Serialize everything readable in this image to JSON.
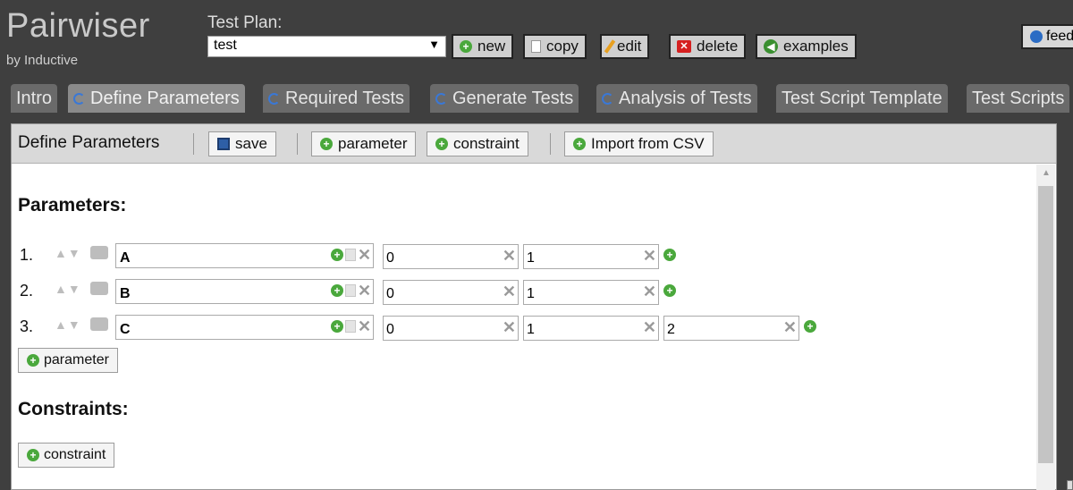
{
  "app": {
    "title": "Pairwiser",
    "byline": "by Inductive"
  },
  "testplan": {
    "label": "Test Plan:",
    "selected": "test",
    "buttons": {
      "new": "new",
      "copy": "copy",
      "edit": "edit",
      "delete": "delete",
      "examples": "examples"
    }
  },
  "feedback_label": "feed",
  "tabs": [
    {
      "label": "Intro"
    },
    {
      "label": "Define Parameters"
    },
    {
      "label": "Required Tests"
    },
    {
      "label": "Generate Tests"
    },
    {
      "label": "Analysis of Tests"
    },
    {
      "label": "Test Script Template"
    },
    {
      "label": "Test Scripts"
    }
  ],
  "toolbar": {
    "title": "Define Parameters",
    "save": "save",
    "parameter": "parameter",
    "constraint": "constraint",
    "import": "Import from CSV"
  },
  "parameters_heading": "Parameters:",
  "parameters": [
    {
      "num": "1.",
      "name": "A",
      "values": [
        "0",
        "1"
      ]
    },
    {
      "num": "2.",
      "name": "B",
      "values": [
        "0",
        "1"
      ]
    },
    {
      "num": "3.",
      "name": "C",
      "values": [
        "0",
        "1",
        "2"
      ]
    }
  ],
  "add_parameter": "parameter",
  "constraints_heading": "Constraints:",
  "add_constraint": "constraint",
  "colors": {
    "accent_green": "#4aa83c",
    "delete_red": "#d62020",
    "tab_spinner": "#3a78d6"
  }
}
